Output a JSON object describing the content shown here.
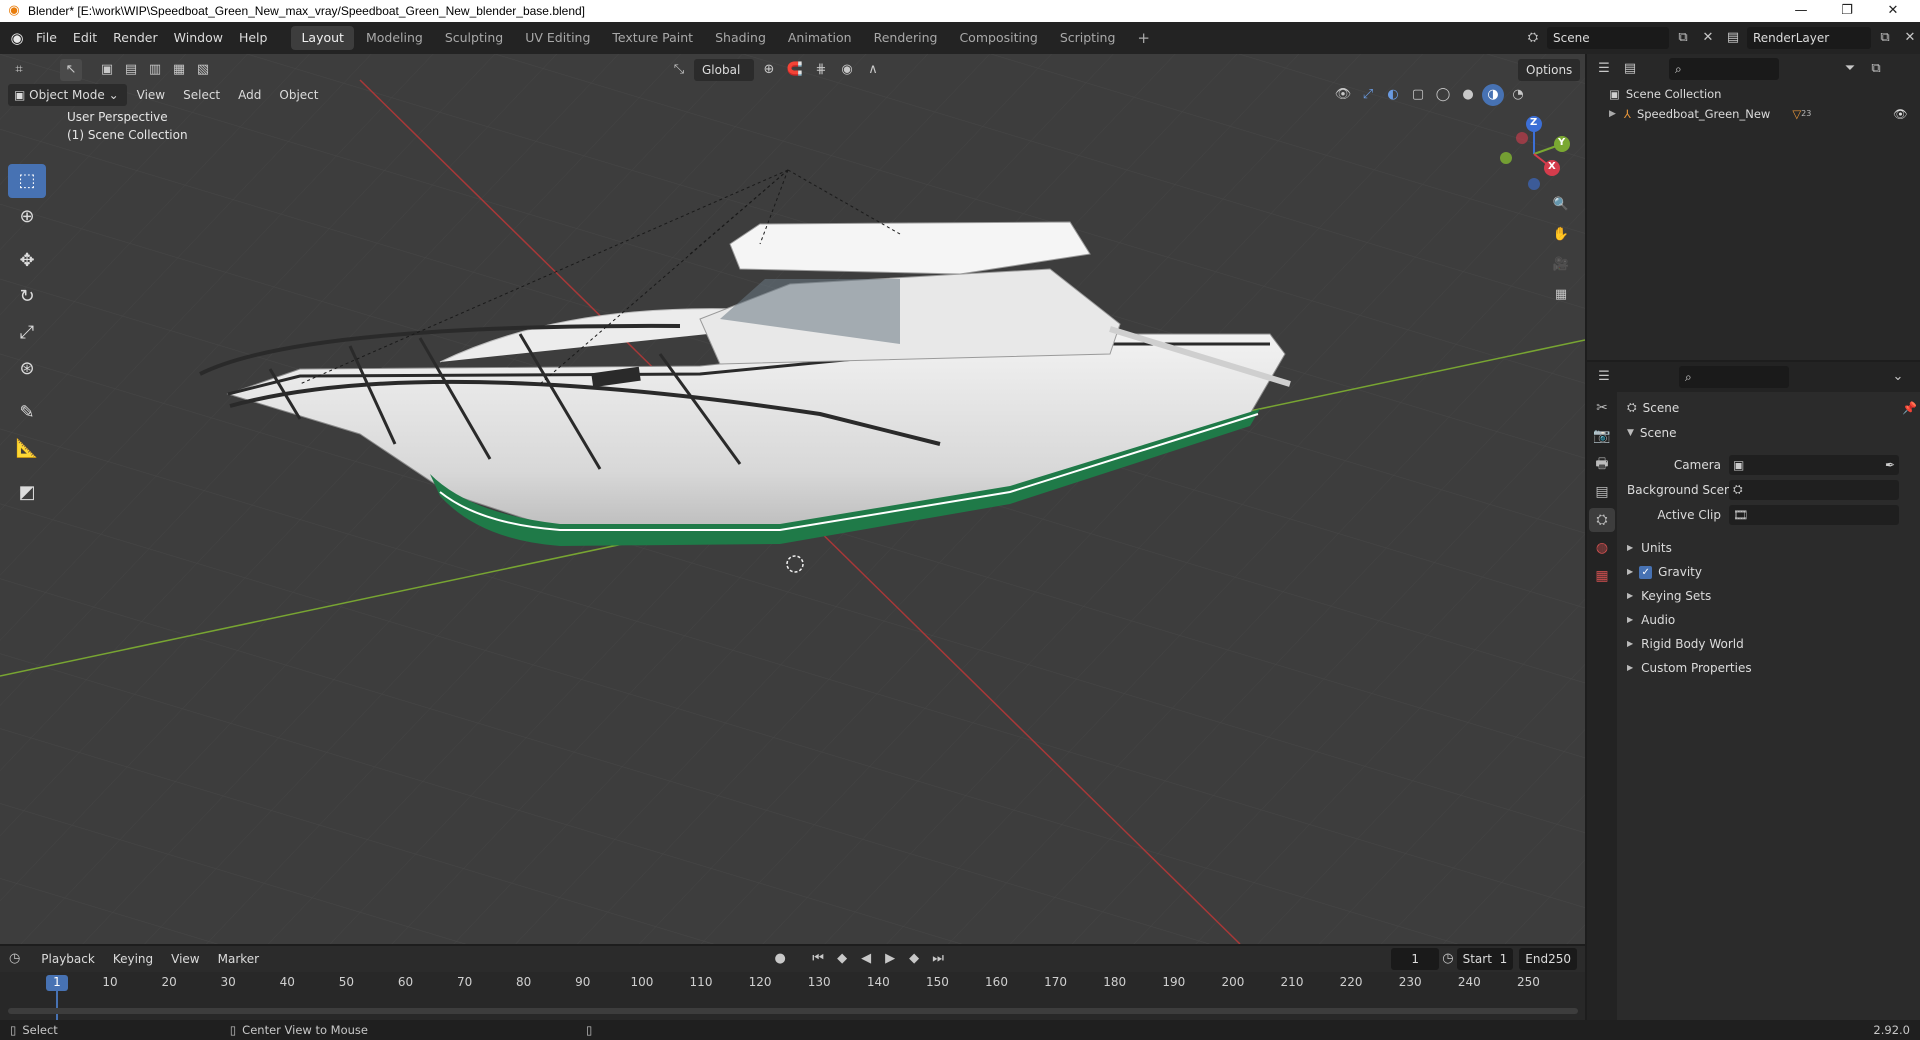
{
  "window": {
    "title": "Blender* [E:\\work\\WIP\\Speedboat_Green_New_max_vray/Speedboat_Green_New_blender_base.blend]",
    "controls": [
      "—",
      "❐",
      "✕"
    ]
  },
  "menubar": {
    "items": [
      "File",
      "Edit",
      "Render",
      "Window",
      "Help"
    ],
    "workspaces": [
      "Layout",
      "Modeling",
      "Sculpting",
      "UV Editing",
      "Texture Paint",
      "Shading",
      "Animation",
      "Rendering",
      "Compositing",
      "Scripting"
    ],
    "active_workspace": "Layout",
    "add_workspace": "+",
    "scene_name": "Scene",
    "view_layer": "RenderLayer"
  },
  "viewport_header": {
    "transform_orientation": "Global",
    "options_label": "Options",
    "mode": "Object Mode",
    "menus": [
      "View",
      "Select",
      "Add",
      "Object"
    ]
  },
  "viewport": {
    "perspective": "User Perspective",
    "collection_info": "(1) Scene Collection",
    "gizmo_axes": [
      "Z",
      "Y",
      "X"
    ],
    "tools": [
      "select-box",
      "cursor",
      "move",
      "rotate",
      "scale",
      "transform",
      "annotate",
      "measure",
      "add-cube"
    ]
  },
  "outliner": {
    "root": "Scene Collection",
    "object": "Speedboat_Green_New",
    "object_badge": "23"
  },
  "properties": {
    "context": "Scene",
    "panel_title": "Scene",
    "fields": [
      {
        "label": "Camera",
        "value": ""
      },
      {
        "label": "Background Scene",
        "value": ""
      },
      {
        "label": "Active Clip",
        "value": ""
      }
    ],
    "subpanels": [
      "Units",
      "Gravity",
      "Keying Sets",
      "Audio",
      "Rigid Body World",
      "Custom Properties"
    ],
    "gravity_checked": true
  },
  "timeline": {
    "menus": [
      "Playback",
      "Keying",
      "View",
      "Marker"
    ],
    "current_frame": "1",
    "start_label": "Start",
    "start": "1",
    "end_label": "End",
    "end": "250",
    "ticks": [
      "1",
      "10",
      "20",
      "30",
      "40",
      "50",
      "60",
      "70",
      "80",
      "90",
      "100",
      "110",
      "120",
      "130",
      "140",
      "150",
      "160",
      "170",
      "180",
      "190",
      "200",
      "210",
      "220",
      "230",
      "240",
      "250"
    ]
  },
  "statusbar": {
    "left_hint": "Select",
    "mid_hint": "Center View to Mouse",
    "version": "2.92.0"
  },
  "colors": {
    "accent": "#4772b3",
    "hull_green": "#1f7a48",
    "x_axis": "#b53a3a",
    "y_axis": "#7aa832"
  }
}
